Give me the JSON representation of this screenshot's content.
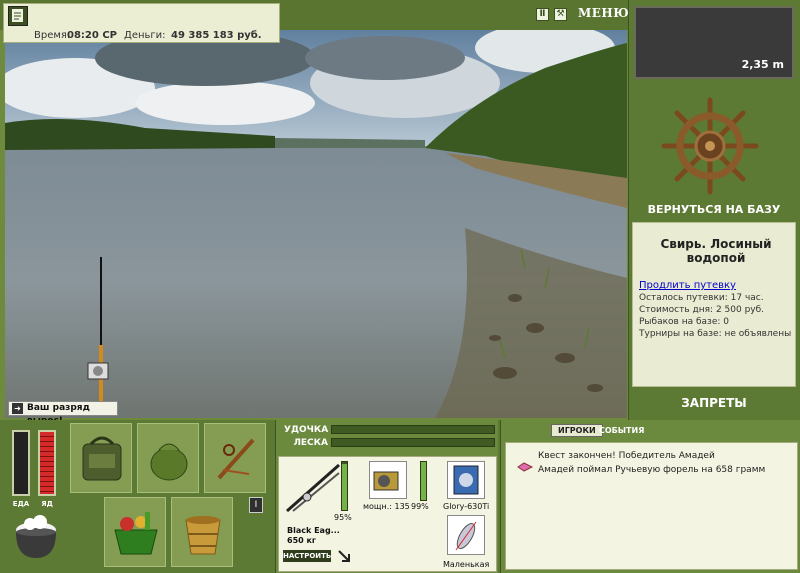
{
  "header": {
    "time_label": "Время:",
    "time_value": "08:20 СР",
    "money_label": "Деньги:",
    "money_value": "49 385 183 руб.",
    "pause_icon": "pause-icon",
    "settings_icon": "tools-icon",
    "menu_label": "МЕНЮ"
  },
  "depth": {
    "value": "2,35 m"
  },
  "base": {
    "return_label": "ВЕРНУТЬСЯ НА БАЗУ"
  },
  "location": {
    "title": "Свирь. Лосиный водопой",
    "extend_link": "Продлить путевку",
    "remaining": "Осталось путевки: 17 час.",
    "day_cost": "Стоимость дня: 2 500 руб.",
    "fishers": "Рыбаков на базе: 0",
    "tournaments": "Турниры на базе: не объявлены"
  },
  "bans_label": "ЗАПРЕТЫ",
  "toast": {
    "text": "Ваш разряд вырос!"
  },
  "meters": {
    "food_label": "ЕДА",
    "food_level": 0,
    "poison_label": "ЯД",
    "poison_level": 1.0
  },
  "tackle": {
    "rod_label": "УДОЧКА",
    "line_label": "ЛЕСКА",
    "rod_name": "Black Eag...",
    "rod_weight": "650 кг",
    "rod_wear": "95%",
    "reel_label": "мощн.: 135",
    "reel_wear": "99%",
    "line_name": "Glory-630Ti",
    "lure_name": "Маленькая",
    "setup_label": "НАСТРОИТЬ",
    "colors": {
      "bar_fill": "#7aa04a",
      "wear_fill": "#75b34a"
    }
  },
  "chat": {
    "tab_players": "ИГРОКИ",
    "tab_events": "СОБЫТИЯ",
    "lines": [
      "Квест закончен! Победитель Амадей",
      "Амадей поймал Ручьевую форель на 658 грамм"
    ]
  },
  "inventory": [
    "backpack-icon",
    "bait-bag-icon",
    "tools-kit-icon",
    "vegetables-basket-icon",
    "bucket-icon"
  ]
}
